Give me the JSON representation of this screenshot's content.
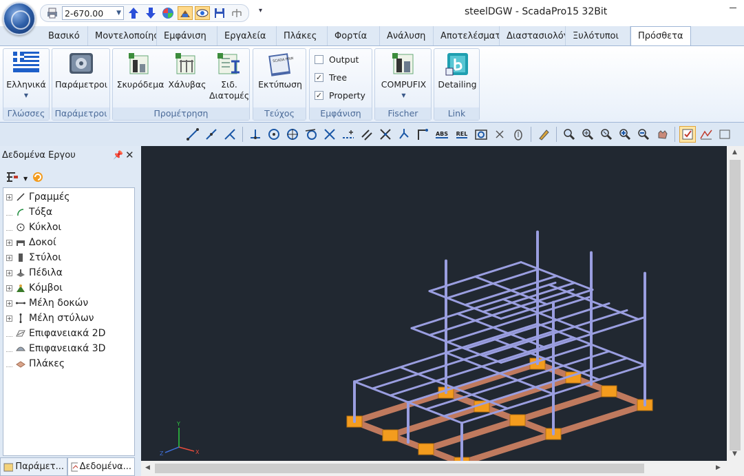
{
  "window": {
    "title": "steelDGW - ScadaPro15 32Bit"
  },
  "quick_access": {
    "level_value": "2-670.00",
    "more": "▾"
  },
  "tabs": [
    {
      "label": "Βασικό"
    },
    {
      "label": "Μοντελοποίηση"
    },
    {
      "label": "Εμφάνιση"
    },
    {
      "label": "Εργαλεία"
    },
    {
      "label": "Πλάκες"
    },
    {
      "label": "Φορτία"
    },
    {
      "label": "Ανάλυση"
    },
    {
      "label": "Αποτελέσματα"
    },
    {
      "label": "Διαστασιολόγηση"
    },
    {
      "label": "Ξυλότυποι"
    },
    {
      "label": "Πρόσθετα"
    }
  ],
  "ribbon": {
    "languages": {
      "button": "Ελληνικά",
      "group": "Γλώσσες"
    },
    "params": {
      "button": "Παράμετροι",
      "group": "Παράμετροι"
    },
    "quantities": {
      "concrete": "Σκυρόδεμα",
      "steel": "Χάλυβας",
      "sections_line1": "Σιδ.",
      "sections_line2": "Διατομές",
      "group": "Προμέτρηση"
    },
    "booklet": {
      "button": "Εκτύπωση",
      "icon_text": "SCADA PRINT OUT",
      "group": "Τεύχος"
    },
    "view": {
      "output": "Output",
      "tree": "Tree",
      "property": "Property",
      "output_checked": false,
      "tree_checked": true,
      "property_checked": true,
      "group": "Εμφάνιση"
    },
    "fischer": {
      "button": "COMPUFIX",
      "group": "Fischer"
    },
    "link": {
      "button": "Detailing",
      "group": "Link"
    }
  },
  "toolbar_icons": [
    "line-icon",
    "polyline-icon",
    "arc-polyline-icon",
    "perpendicular-icon",
    "center-icon",
    "node-icon",
    "tangent-icon",
    "intersection-icon",
    "midpoint-icon",
    "parallel-icon",
    "cross-icon",
    "extend-icon",
    "corner-icon",
    "abs-icon",
    "rel-icon",
    "camera-icon",
    "cancel-snap-icon",
    "lock-icon",
    "pencil-icon",
    "zoom-window-icon",
    "zoom-all-icon",
    "zoom-previous-icon",
    "zoom-in-icon",
    "zoom-out-icon",
    "pan-icon",
    "checkbox-toggle-icon",
    "chart-icon",
    "extra-icon"
  ],
  "toolbar_text": {
    "abs": "ABS",
    "rel": "REL"
  },
  "left_panel": {
    "title": "Δεδομένα Εργου",
    "tree": [
      {
        "label": "Γραμμές",
        "expandable": true
      },
      {
        "label": "Τόξα",
        "expandable": false
      },
      {
        "label": "Κύκλοι",
        "expandable": false
      },
      {
        "label": "Δοκοί",
        "expandable": true
      },
      {
        "label": "Στύλοι",
        "expandable": true
      },
      {
        "label": "Πέδιλα",
        "expandable": true
      },
      {
        "label": "Κόμβοι",
        "expandable": true
      },
      {
        "label": "Μέλη δοκών",
        "expandable": true
      },
      {
        "label": "Μέλη στύλων",
        "expandable": true
      },
      {
        "label": "Επιφανειακά 2D",
        "expandable": false
      },
      {
        "label": "Επιφανειακά 3D",
        "expandable": false
      },
      {
        "label": "Πλάκες",
        "expandable": false
      }
    ],
    "bottom_tabs": [
      {
        "label": "Παράμετ..."
      },
      {
        "label": "Δεδομένα..."
      }
    ]
  },
  "viewport": {
    "axes": {
      "x": "X",
      "y": "Y",
      "z": "Z"
    },
    "colors": {
      "background": "#212831",
      "members": "#9a9ee0",
      "footing": "#f39c1e",
      "tie_beam": "#c07a5e"
    }
  }
}
